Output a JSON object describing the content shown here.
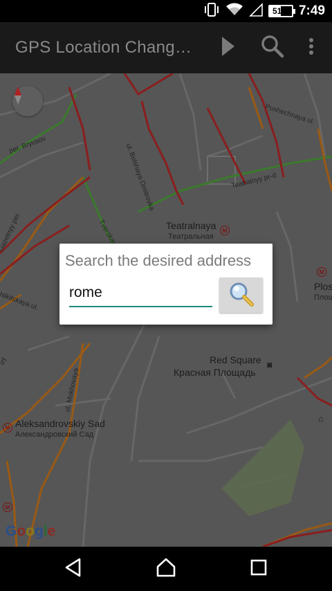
{
  "status_bar": {
    "battery_text": "51%",
    "time": "7:49",
    "icons": [
      "vibrate-icon",
      "wifi-icon",
      "signal-icon",
      "battery-icon"
    ]
  },
  "app_bar": {
    "title": "GPS Location Chang…",
    "actions": [
      "play-icon",
      "search-icon",
      "overflow-menu-icon"
    ]
  },
  "map": {
    "labels": {
      "teatralnaya": "Teatralnaya",
      "teatralnaya_ru": "Театральная",
      "red_square": "Red Square",
      "red_square_ru": "Красная Площадь",
      "aleksandrovskiy": "Aleksandrovskiy Sad",
      "aleksandrovskiy_ru": "Александровский Сад",
      "plos": "Plos",
      "plos_ru": "Плош",
      "pushechnaya": "Pushechnaya ul.",
      "teatralnyy": "Teatralnyy pr-d",
      "bolshaya_dmitrovka": "ul. Bolshaya Dmitrovka",
      "bryusov": "per. Bryusov",
      "tverskaya": "Tverskaya",
      "gazetnyy": "Gazetnyy per.",
      "nikitskaya": "B. Nikitskaya ul.",
      "mokhovaya": "ul. Mokhovaya",
      "oy": "oy"
    },
    "google_logo": [
      "G",
      "o",
      "o",
      "g",
      "l",
      "e"
    ],
    "colors": {
      "traffic_red": "#8a1e1e",
      "traffic_orange": "#9a5a14",
      "traffic_green": "#3b7a2c",
      "road_light": "#6e6e6e",
      "park": "#5e6b4f"
    }
  },
  "dialog": {
    "title": "Search the desired address",
    "input_value": "rome",
    "button_icon": "magnifier-icon",
    "accent": "#1a8a7a"
  },
  "nav_bar": {
    "buttons": [
      "back-icon",
      "home-icon",
      "recents-icon"
    ]
  }
}
